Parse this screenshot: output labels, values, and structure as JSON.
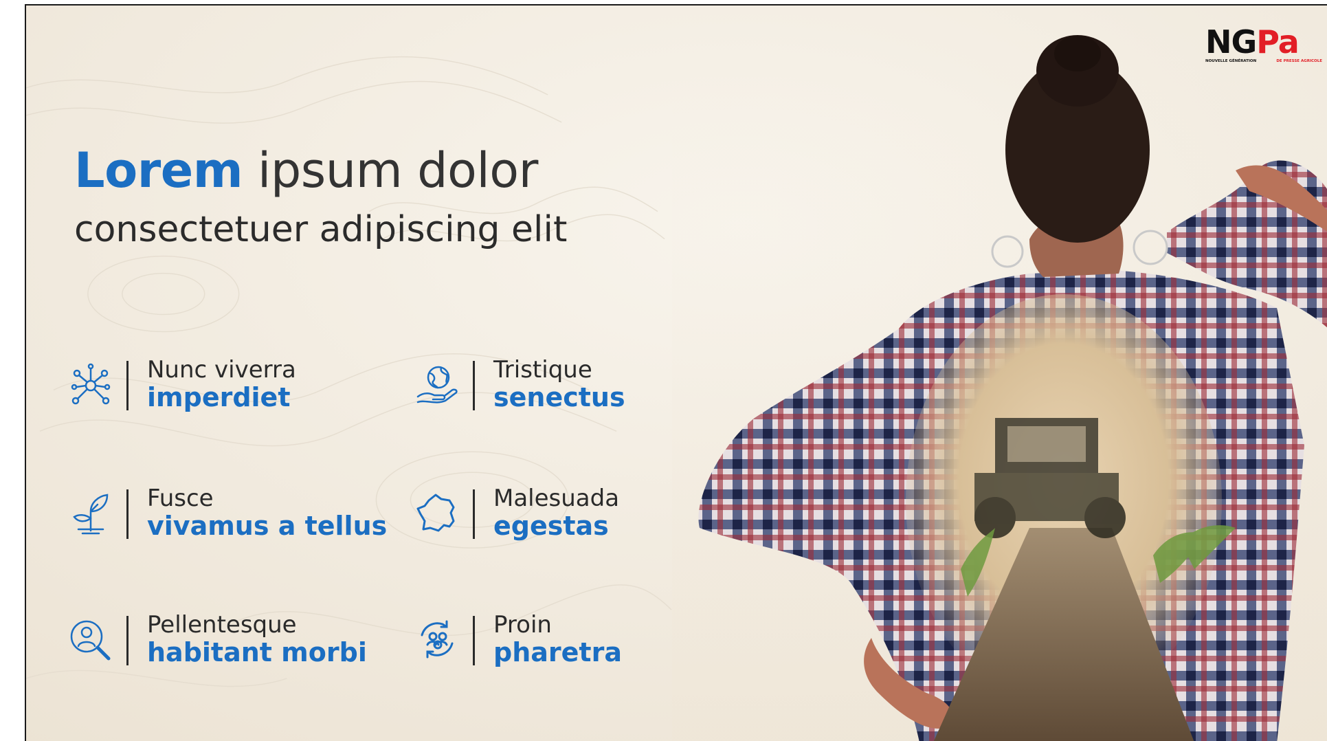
{
  "headline": {
    "emphasis": "Lorem",
    "rest": "ipsum dolor"
  },
  "subheadline": "consectetuer adipiscing elit",
  "logo": {
    "mark_left": "NG",
    "mark_right": "Pa",
    "tagline_left": "NOUVELLE GÉNÉRATION",
    "tagline_right": "DE PRESSE AGRICOLE"
  },
  "features": [
    {
      "icon": "network-icon",
      "line1": "Nunc viverra",
      "line2": "imperdiet"
    },
    {
      "icon": "globe-in-hand-icon",
      "line1": "Tristique",
      "line2": "senectus"
    },
    {
      "icon": "sprout-icon",
      "line1": "Fusce",
      "line2": "vivamus a tellus"
    },
    {
      "icon": "france-map-icon",
      "line1": "Malesuada",
      "line2": "egestas"
    },
    {
      "icon": "person-search-icon",
      "line1": "Pellentesque",
      "line2": "habitant morbi"
    },
    {
      "icon": "people-cycle-icon",
      "line1": "Proin",
      "line2": "pharetra"
    }
  ],
  "colors": {
    "accent": "#1b6ec2",
    "text": "#2a2a2a",
    "logo_red": "#e21e26",
    "background": "#f4efe6"
  }
}
